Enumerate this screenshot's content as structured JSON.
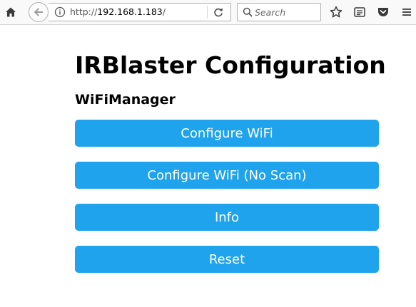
{
  "browser": {
    "url_prefix": "http://",
    "url_host": "192.168.1.183",
    "url_suffix": "/",
    "search_placeholder": "Search"
  },
  "page": {
    "title": "IRBlaster Configuration",
    "subtitle": "WiFiManager",
    "buttons": [
      {
        "label": "Configure WiFi"
      },
      {
        "label": "Configure WiFi (No Scan)"
      },
      {
        "label": "Info"
      },
      {
        "label": "Reset"
      }
    ]
  },
  "colors": {
    "button_bg": "#1fa3ec",
    "button_text": "#ffffff",
    "toolbar_bg": "#f9f9fa"
  },
  "icons": [
    "home-icon",
    "back-arrow-icon",
    "info-icon",
    "reload-icon",
    "search-icon",
    "bookmark-star-icon",
    "reader-view-icon",
    "pocket-icon",
    "overflow-menu-icon"
  ]
}
